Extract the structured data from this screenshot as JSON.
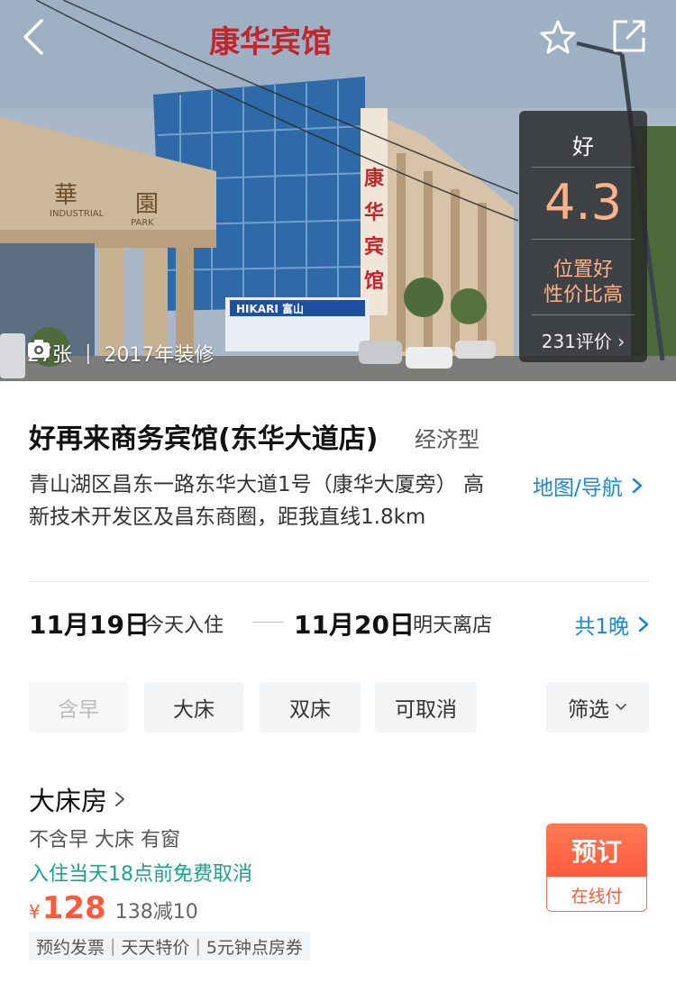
{
  "hero": {
    "photo_count": "27张",
    "renovation": "2017年装修",
    "sign_text": "康华宾馆",
    "sign_text_vertical": "康华宾馆",
    "gate_text_left": "華",
    "gate_text_right": "園",
    "gate_sub": "INDUSTRIAL PARK",
    "store_sign": "HIKARI 富山"
  },
  "rating": {
    "level": "好",
    "score": "4.3",
    "tag1": "位置好",
    "tag2": "性价比高",
    "review_count": "231评价",
    "accent_color": "#ffb18a"
  },
  "hotel": {
    "name": "好再来商务宾馆(东华大道店)",
    "type": "经济型",
    "address": "青山湖区昌东一路东华大道1号（康华大厦旁） 高新技术开发区及昌东商圈，距我直线1.8km",
    "map_link": "地图/导航"
  },
  "dates": {
    "checkin_date": "11月19日",
    "checkin_label": "今天入住",
    "checkout_date": "11月20日",
    "checkout_label": "明天离店",
    "nights": "共1晚"
  },
  "filters": {
    "items": [
      "含早",
      "大床",
      "双床",
      "可取消"
    ],
    "more": "筛选"
  },
  "room": {
    "title": "大床房",
    "features": "不含早 大床 有窗",
    "cancel_policy": "入住当天18点前免费取消",
    "currency": "¥",
    "price": "128",
    "discount": "138减10",
    "tags": [
      "预约发票",
      "天天特价",
      "5元钟点房券"
    ],
    "book_label": "预订",
    "pay_label": "在线付"
  },
  "colors": {
    "link": "#1a88d9",
    "price": "#ff5a3d",
    "cancel": "#1aa28c"
  }
}
